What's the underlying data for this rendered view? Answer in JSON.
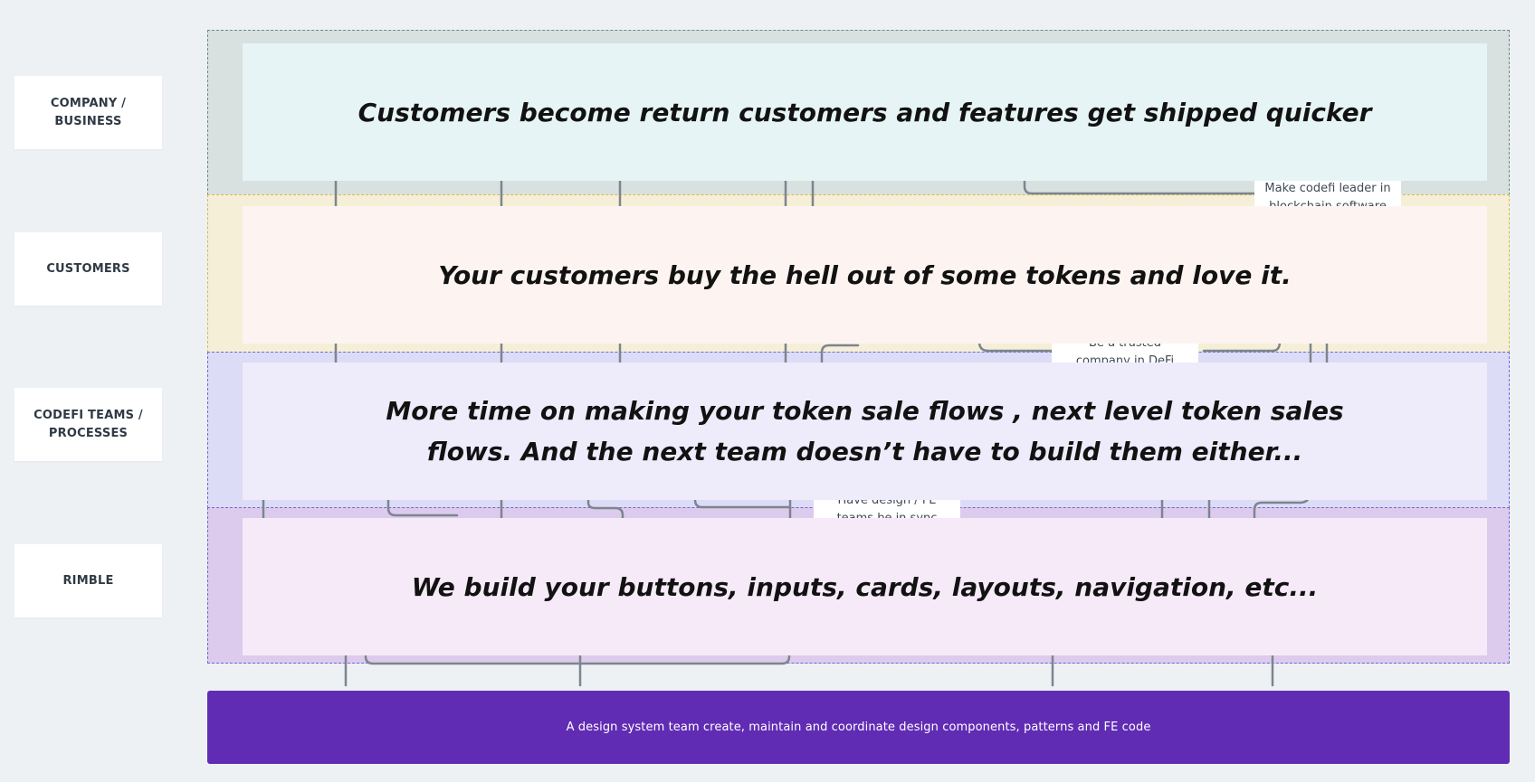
{
  "row_labels": {
    "company": [
      "COMPANY /",
      "BUSINESS"
    ],
    "customers": [
      "CUSTOMERS"
    ],
    "teams": [
      "CODEFI TEAMS /",
      "PROCESSES"
    ],
    "rimble": [
      "RIMBLE"
    ]
  },
  "panels": {
    "company": "Customers become return customers and features get shipped quicker",
    "customers": "Your customers buy the hell out of some tokens and love it.",
    "teams": "More time on making your token sale flows , next level token sales flows. And the next team doesn’t have to build them either...",
    "rimble": "We build your buttons, inputs, cards, layouts, navigation, etc..."
  },
  "sticky_notes": {
    "leader": [
      "Make codefi leader in",
      "blockchain software"
    ],
    "trusted": [
      "Be a trusted",
      "company in DeFi"
    ],
    "sync": [
      "Have design / FE",
      "teams be in sync"
    ]
  },
  "banner": {
    "text": "A design system team create, maintain and coordinate design components, patterns and FE code"
  },
  "colors": {
    "background": "#eef1f4",
    "company_lane": "#d8e1df",
    "customers_lane": "#f6efd8",
    "teams_lane": "#dddcf6",
    "rimble_lane": "#dccbec",
    "banner": "#612cb4"
  }
}
